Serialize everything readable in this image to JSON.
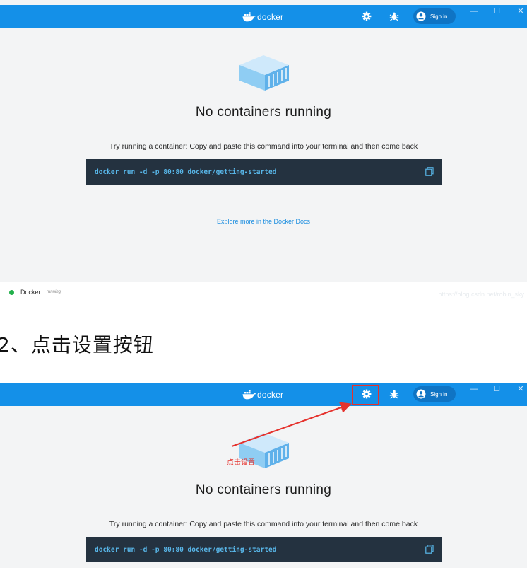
{
  "app": {
    "logo_text": "docker",
    "sign_in_label": "Sign in"
  },
  "window_controls": {
    "minimize": "—",
    "maximize": "☐",
    "close": "✕"
  },
  "empty_state": {
    "title": "No containers running",
    "instruction": "Try running a container: Copy and paste this command into your terminal and then come back",
    "command": "docker run -d -p 80:80 docker/getting-started",
    "docs_link": "Explore more in the Docker Docs"
  },
  "status_bar": {
    "engine_name": "Docker",
    "engine_state": "running",
    "watermark": "https://blog.csdn.net/robin_sky"
  },
  "step_heading": "2、点击设置按钮",
  "annotation": {
    "label": "点击设置",
    "color": "#e5322d"
  },
  "colors": {
    "titlebar": "#1490e8",
    "command_bg": "#243240",
    "command_text": "#58b6e8",
    "status_dot": "#22b04b",
    "link": "#1c8ee0"
  },
  "icons": [
    "docker-whale-icon",
    "gear-icon",
    "bug-icon",
    "user-circle-icon",
    "container-cube-icon",
    "copy-icon"
  ]
}
